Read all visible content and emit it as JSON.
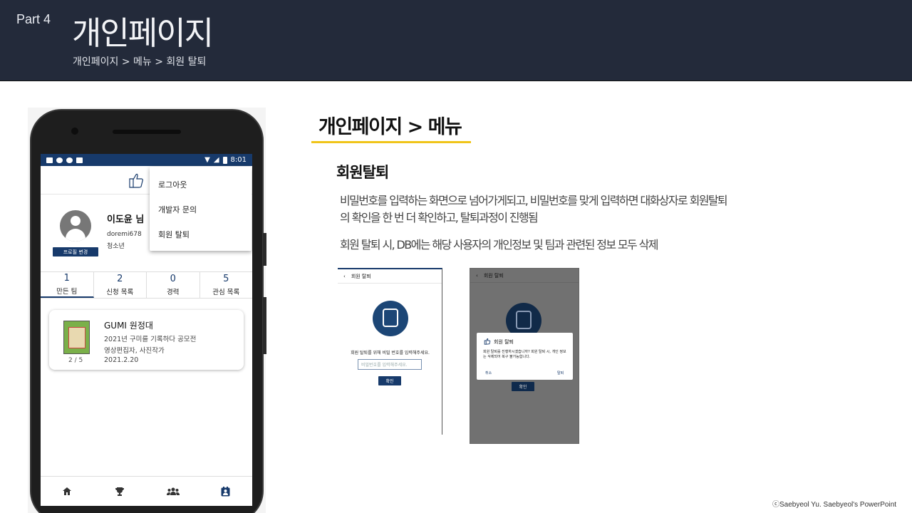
{
  "header": {
    "part": "Part 4",
    "title": "개인페이지",
    "breadcrumb": "개인페이지 > 메뉴 > 회원 탈퇴"
  },
  "phone": {
    "status_time": "8:01",
    "menu": [
      "로그아웃",
      "개발자 문의",
      "회원 탈퇴"
    ],
    "profile": {
      "name": "이도윤 님",
      "id": "doremi678",
      "level": "청소년",
      "edit_label": "프로필 변경"
    },
    "stats": [
      {
        "num": "1",
        "label": "만든 팀"
      },
      {
        "num": "2",
        "label": "신청 목록"
      },
      {
        "num": "0",
        "label": "경력"
      },
      {
        "num": "5",
        "label": "관심 목록"
      }
    ],
    "card": {
      "title": "GUMI 원정대",
      "line1": "2021년 구미를 기록하다 공모전",
      "line2": "영상편집자, 사진작가",
      "date": "2021.2.20",
      "pages": "2 / 5"
    },
    "nav_icons": [
      "home-icon",
      "trophy-icon",
      "group-icon",
      "badge-icon"
    ]
  },
  "content": {
    "section_title": "개인페이지 > 메뉴",
    "sub_title": "회원탈퇴",
    "para1_a": "비밀번호를 입력하는 화면으로 넘어가게되고, 비밀번호를 맞게 입력하면 대화상자로 회원탈퇴",
    "para1_b": "의 확인을 한 번 더 확인하고, 탈퇴과정이 진행됨",
    "para2": "회원 탈퇴 시, DB에는 해당 사용자의 개인정보 및 팀과 관련된 정보 모두 삭제"
  },
  "shot1": {
    "title": "회원 탈퇴",
    "prompt": "회원 탈퇴를 위해 비밀 번호를 입력해주세요.",
    "placeholder": "비밀번호를 입력해주세요.",
    "confirm": "확인"
  },
  "shot2": {
    "title": "회원 탈퇴",
    "dialog_title": "회원 탈퇴",
    "dialog_body": "회원 탈퇴를 진행하시겠습니까? 회원 탈퇴 시, 개인 정보는 삭제되어 복구 불가능합니다.",
    "cancel": "취소",
    "ok": "탈퇴",
    "confirm": "확인"
  },
  "footer": "ⓒSaebyeol Yu. Saebyeol's PowerPoint",
  "colors": {
    "header_bg": "#232a3a",
    "accent": "#f0c419",
    "app_blue": "#173a6b"
  }
}
